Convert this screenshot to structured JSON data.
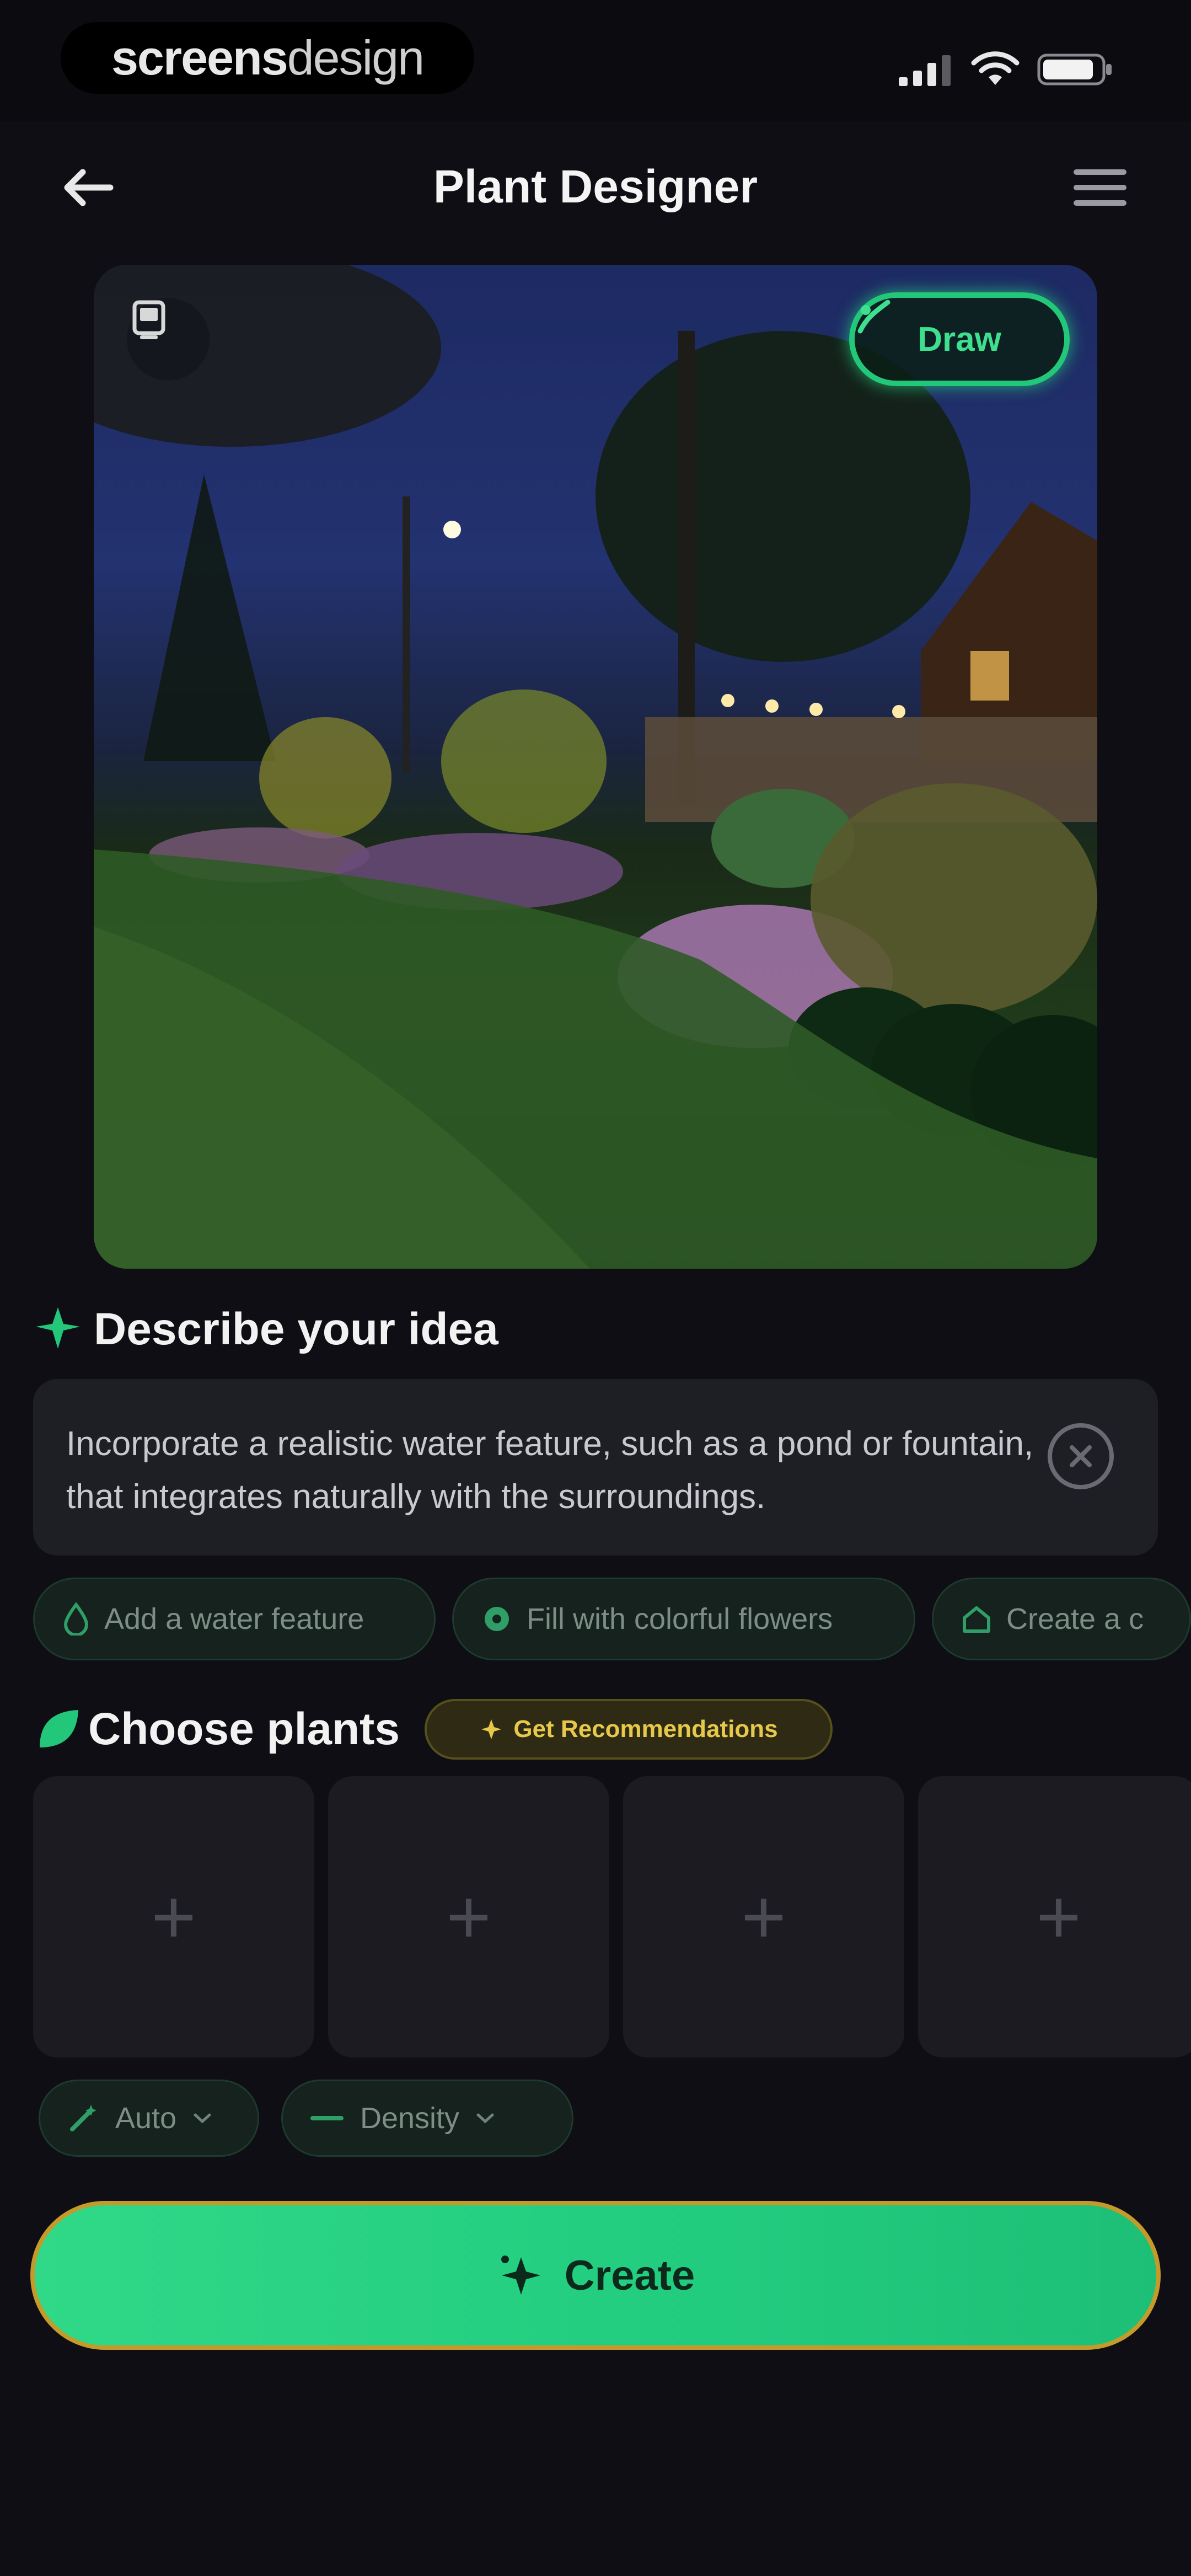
{
  "status_bar": {
    "brand_bold": "screens",
    "brand_thin": "design"
  },
  "header": {
    "title": "Plant Designer"
  },
  "photo": {
    "draw_label": "Draw"
  },
  "idea": {
    "title": "Describe your idea",
    "text": "Incorporate a realistic water feature, such as a pond or fountain, that integrates naturally with the surroundings.",
    "suggestions": [
      {
        "label": "Add a water feature",
        "icon": "droplet-icon"
      },
      {
        "label": "Fill with colorful flowers",
        "icon": "flower-icon"
      },
      {
        "label": "Create a c",
        "icon": "house-icon"
      }
    ]
  },
  "plants": {
    "title": "Choose plants",
    "recommend_label": "Get Recommendations",
    "slot_symbol": "+"
  },
  "options": {
    "auto_label": "Auto",
    "density_label": "Density"
  },
  "create": {
    "label": "Create"
  },
  "colors": {
    "accent_green": "#22c77a",
    "recommend_yellow": "#e7c94a",
    "background": "#0e0e14"
  }
}
